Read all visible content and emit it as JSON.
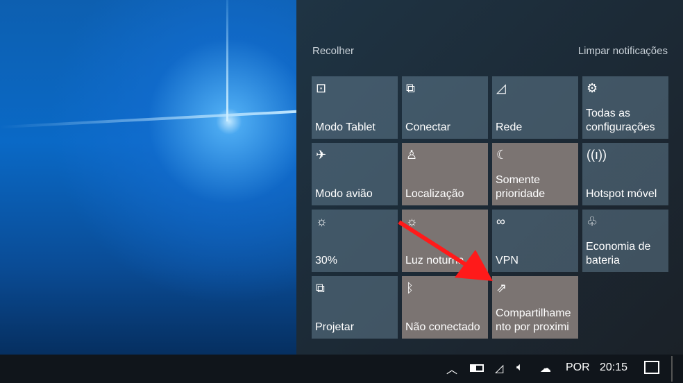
{
  "action_center": {
    "collapse_label": "Recolher",
    "clear_label": "Limpar notificações",
    "tiles": [
      {
        "label": "Modo Tablet",
        "icon": "tablet-icon",
        "glyph": "⊡",
        "active": false
      },
      {
        "label": "Conectar",
        "icon": "connect-icon",
        "glyph": "⧉",
        "active": false
      },
      {
        "label": "Rede",
        "icon": "network-icon",
        "glyph": "◿",
        "active": false
      },
      {
        "label": "Todas as\nconfigurações",
        "icon": "gear-icon",
        "glyph": "⚙",
        "active": false
      },
      {
        "label": "Modo avião",
        "icon": "airplane-icon",
        "glyph": "✈",
        "active": false
      },
      {
        "label": "Localização",
        "icon": "location-icon",
        "glyph": "♙",
        "active": true
      },
      {
        "label": "Somente\nprioridade",
        "icon": "moon-icon",
        "glyph": "☾",
        "active": true
      },
      {
        "label": "Hotspot móvel",
        "icon": "hotspot-icon",
        "glyph": "((ı))",
        "active": false
      },
      {
        "label": "30%",
        "icon": "brightness-icon",
        "glyph": "☼",
        "active": false
      },
      {
        "label": "Luz noturna",
        "icon": "night-light-icon",
        "glyph": "☼",
        "active": true
      },
      {
        "label": "VPN",
        "icon": "vpn-icon",
        "glyph": "∞",
        "active": false
      },
      {
        "label": "Economia de\nbateria",
        "icon": "battery-saver-icon",
        "glyph": "♧",
        "active": false
      },
      {
        "label": "Projetar",
        "icon": "project-icon",
        "glyph": "⧉",
        "active": false
      },
      {
        "label": "Não conectado",
        "icon": "bluetooth-icon",
        "glyph": "ᛒ",
        "active": true
      },
      {
        "label": "Compartilhame\nnto por proximi",
        "icon": "nearby-share-icon",
        "glyph": "⇗",
        "active": true
      }
    ]
  },
  "taskbar": {
    "language": "POR",
    "time": "20:15"
  },
  "colors": {
    "arrow": "#ff1a1a",
    "active_tile": "#7b7472"
  }
}
